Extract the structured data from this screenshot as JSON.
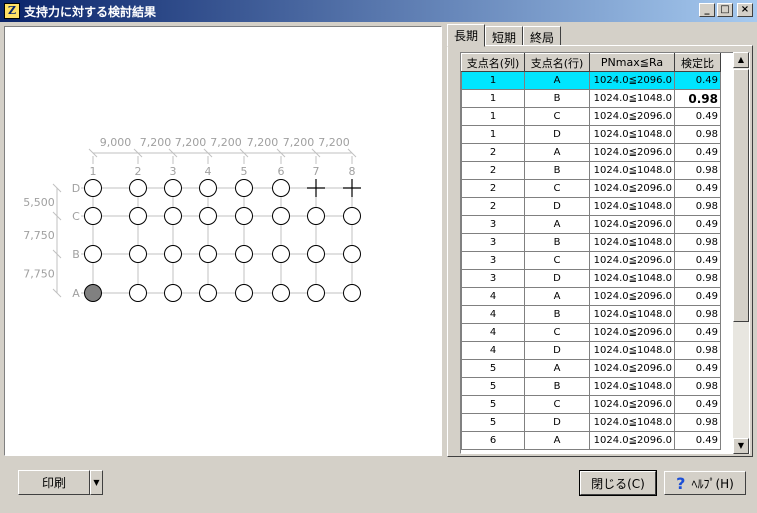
{
  "window": {
    "title": "支持力に対する検討結果",
    "icon": "app-logo-icon",
    "minimize_glyph": "_",
    "maximize_glyph": "□",
    "close_glyph": "×"
  },
  "tabs": [
    {
      "label": "長期",
      "active": true
    },
    {
      "label": "短期",
      "active": false
    },
    {
      "label": "終局",
      "active": false
    }
  ],
  "table": {
    "headers": [
      "支点名(列)",
      "支点名(行)",
      "PNmax≦Ra",
      "検定比"
    ],
    "rows": [
      [
        "1",
        "A",
        "1024.0≦2096.0",
        "0.49"
      ],
      [
        "1",
        "B",
        "1024.0≦1048.0",
        "0.98"
      ],
      [
        "1",
        "C",
        "1024.0≦2096.0",
        "0.49"
      ],
      [
        "1",
        "D",
        "1024.0≦1048.0",
        "0.98"
      ],
      [
        "2",
        "A",
        "1024.0≦2096.0",
        "0.49"
      ],
      [
        "2",
        "B",
        "1024.0≦1048.0",
        "0.98"
      ],
      [
        "2",
        "C",
        "1024.0≦2096.0",
        "0.49"
      ],
      [
        "2",
        "D",
        "1024.0≦1048.0",
        "0.98"
      ],
      [
        "3",
        "A",
        "1024.0≦2096.0",
        "0.49"
      ],
      [
        "3",
        "B",
        "1024.0≦1048.0",
        "0.98"
      ],
      [
        "3",
        "C",
        "1024.0≦2096.0",
        "0.49"
      ],
      [
        "3",
        "D",
        "1024.0≦1048.0",
        "0.98"
      ],
      [
        "4",
        "A",
        "1024.0≦2096.0",
        "0.49"
      ],
      [
        "4",
        "B",
        "1024.0≦1048.0",
        "0.98"
      ],
      [
        "4",
        "C",
        "1024.0≦2096.0",
        "0.49"
      ],
      [
        "4",
        "D",
        "1024.0≦1048.0",
        "0.98"
      ],
      [
        "5",
        "A",
        "1024.0≦2096.0",
        "0.49"
      ],
      [
        "5",
        "B",
        "1024.0≦1048.0",
        "0.98"
      ],
      [
        "5",
        "C",
        "1024.0≦2096.0",
        "0.49"
      ],
      [
        "5",
        "D",
        "1024.0≦1048.0",
        "0.98"
      ],
      [
        "6",
        "A",
        "1024.0≦2096.0",
        "0.49"
      ]
    ],
    "selected_row": 0,
    "bold_row": 1,
    "selected_color": "#00e5ff"
  },
  "diagram": {
    "span_labels": [
      "9,000",
      "7,200",
      "7,200",
      "7,200",
      "7,200",
      "7,200",
      "7,200"
    ],
    "column_labels": [
      "1",
      "2",
      "3",
      "4",
      "5",
      "6",
      "7",
      "8"
    ],
    "row_labels": [
      "D",
      "C",
      "B",
      "A"
    ],
    "row_span_labels": [
      "5,500",
      "7,750",
      "7,750"
    ],
    "selected_node": {
      "column": "1",
      "row": "A"
    },
    "cross_nodes": [
      {
        "column": "7",
        "row": "D"
      },
      {
        "column": "8",
        "row": "D"
      }
    ]
  },
  "buttons": {
    "print": "印刷",
    "print_dropdown_icon": "dropdown-arrow-icon",
    "close": "閉じる(C)",
    "help": "ﾍﾙﾌﾟ(H)",
    "help_icon": "question-icon"
  }
}
